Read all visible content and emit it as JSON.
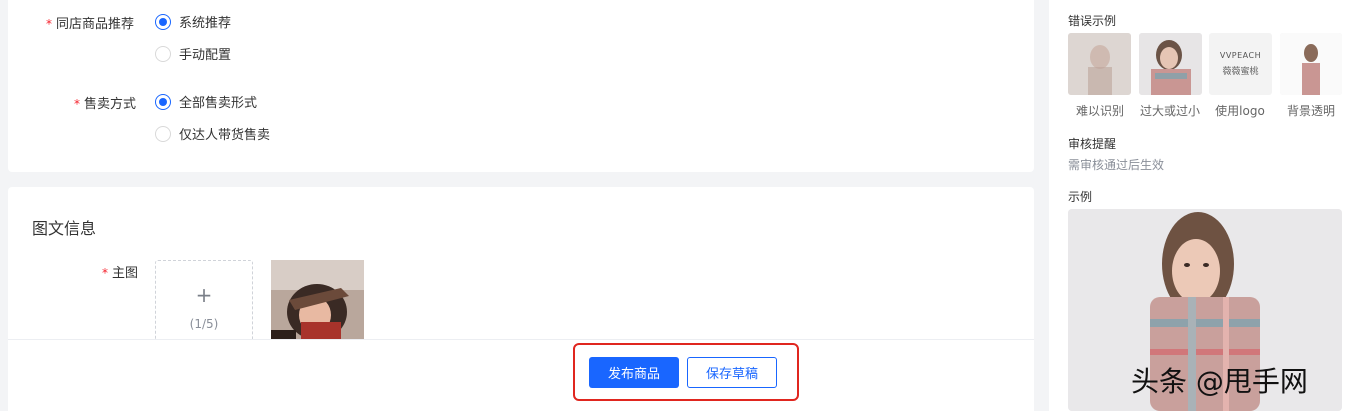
{
  "basic": {
    "same_store": {
      "label": "同店商品推荐",
      "options": [
        "系统推荐",
        "手动配置"
      ],
      "selected": "系统推荐"
    },
    "sale_method": {
      "label": "售卖方式",
      "options": [
        "全部售卖形式",
        "仅达人带货售卖"
      ],
      "selected": "全部售卖形式"
    }
  },
  "image_section": {
    "title": "图文信息",
    "main_image_label": "主图",
    "upload_plus": "+",
    "upload_count": "(1/5)"
  },
  "footer": {
    "publish_label": "发布商品",
    "draft_label": "保存草稿"
  },
  "sidebar": {
    "error_title": "错误示例",
    "examples": [
      {
        "label": "难以识别"
      },
      {
        "label": "过大或过小"
      },
      {
        "label": "使用logo",
        "logo_line1": "VVPEACH",
        "logo_line2": "薇薇蜜桃"
      },
      {
        "label": "背景透明"
      }
    ],
    "review_title": "审核提醒",
    "review_text": "需审核通过后生效",
    "sample_title": "示例"
  },
  "watermark": "头条 @甩手网",
  "colors": {
    "accent": "#1966ff",
    "required": "#f5222d",
    "highlight": "#e0261f"
  }
}
